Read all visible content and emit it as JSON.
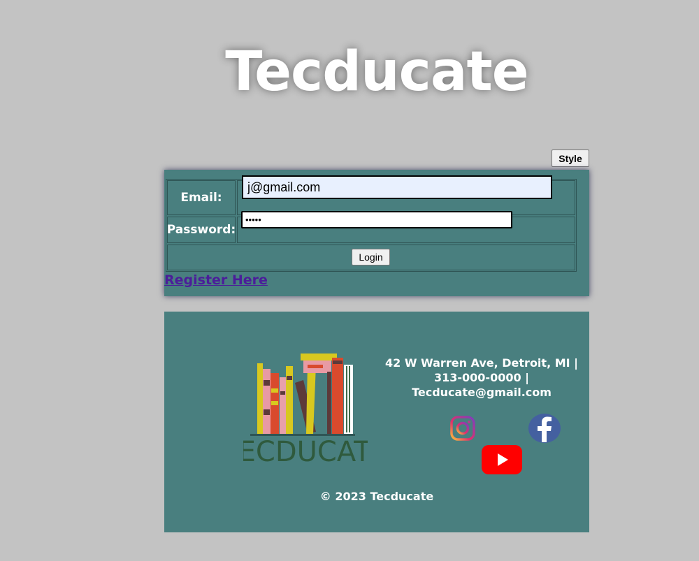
{
  "site": {
    "title": "Tecducate"
  },
  "toolbar": {
    "style_label": "Style"
  },
  "login": {
    "email_label": "Email:",
    "email_value": "j@gmail.com",
    "password_label": "Password:",
    "password_value": "•••••",
    "login_label": "Login",
    "register_label": "Register Here"
  },
  "footer": {
    "logo_text": "TECDUCATE",
    "address": "42 W Warren Ave, Detroit, MI |",
    "phone": "313-000-0000 |",
    "email": "Tecducate@gmail.com",
    "copyright": "© 2023 Tecducate",
    "social": [
      "instagram-icon",
      "facebook-icon",
      "youtube-icon"
    ]
  },
  "colors": {
    "page_background": "#c3c3c3",
    "panel_background": "#497f7f",
    "link": "#4b1d9a",
    "youtube_red": "#ff0000",
    "facebook_blue": "#4460a0"
  }
}
